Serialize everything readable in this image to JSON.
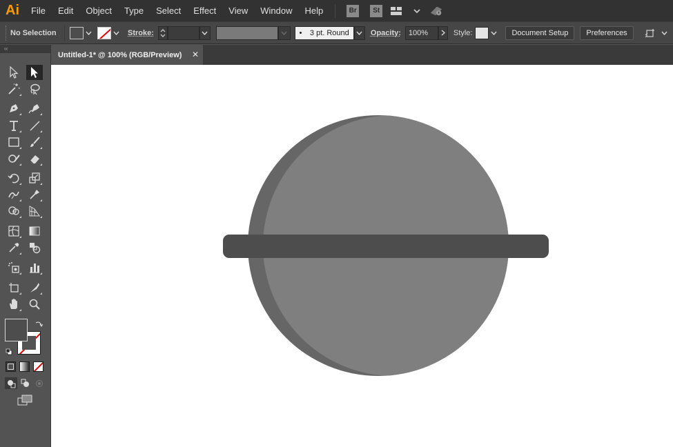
{
  "app": {
    "logo": "Ai"
  },
  "menu": {
    "items": [
      "File",
      "Edit",
      "Object",
      "Type",
      "Select",
      "Effect",
      "View",
      "Window",
      "Help"
    ],
    "bridge": "Br",
    "stock": "St"
  },
  "control_bar": {
    "selection": "No Selection",
    "stroke_label": "Stroke:",
    "brush": "3 pt. Round",
    "opacity_label": "Opacity:",
    "opacity_value": "100%",
    "style_label": "Style:",
    "document_setup": "Document Setup",
    "preferences": "Preferences"
  },
  "document_tab": {
    "title": "Untitled-1* @ 100% (RGB/Preview)",
    "close": "✕"
  },
  "tools_header": "‹‹",
  "colors": {
    "menu_bg": "#323232",
    "panel_bg": "#535353",
    "accent": "#ff9a00",
    "circle_shadow": "#666666",
    "circle_face": "#7f7f7f",
    "band": "#4d4d4d",
    "fill_swatch": "#4d4d4d"
  },
  "artwork": {
    "shapes": [
      "circle-shadow",
      "circle-face",
      "horizontal-band"
    ]
  }
}
